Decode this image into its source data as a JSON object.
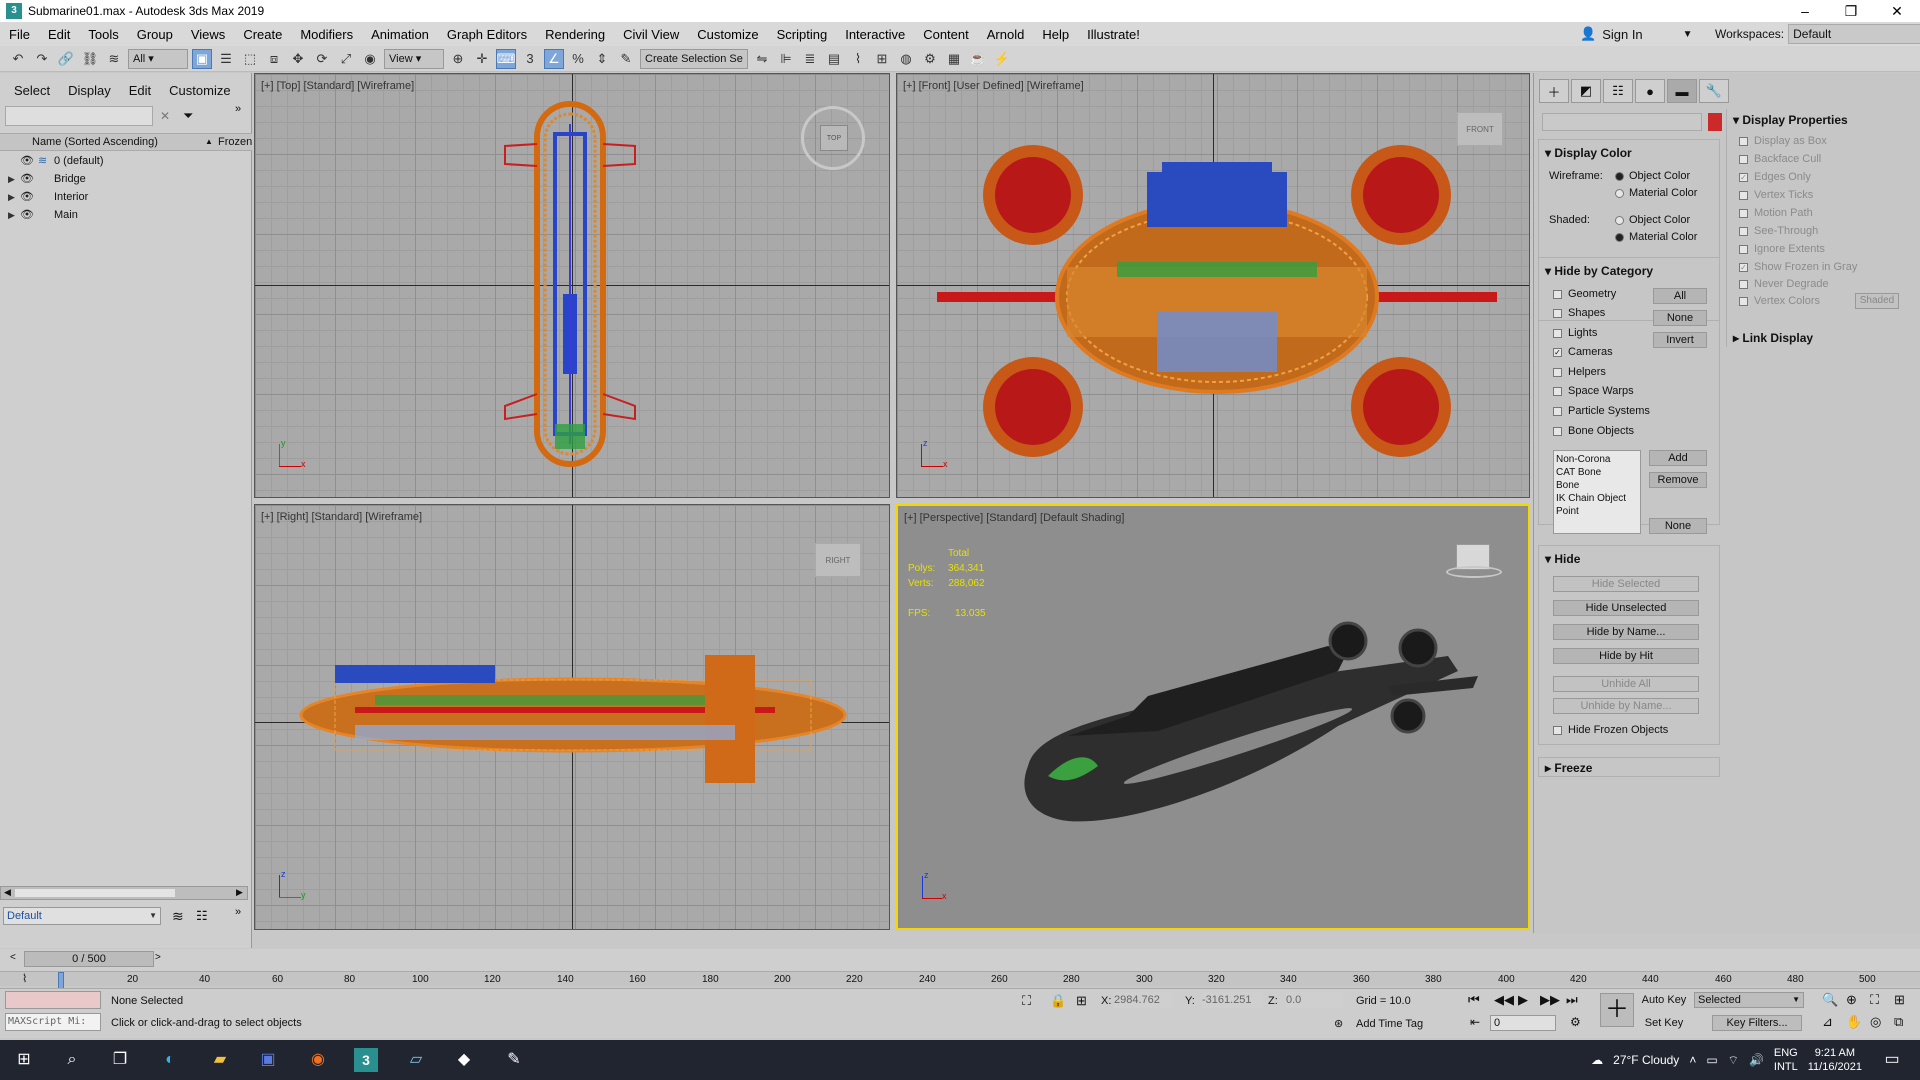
{
  "window": {
    "title": "Submarine01.max - Autodesk 3ds Max 2019",
    "min": "–",
    "max": "❐",
    "close": "✕"
  },
  "menu": [
    "File",
    "Edit",
    "Tools",
    "Group",
    "Views",
    "Create",
    "Modifiers",
    "Animation",
    "Graph Editors",
    "Rendering",
    "Civil View",
    "Customize",
    "Scripting",
    "Interactive",
    "Content",
    "Arnold",
    "Help",
    "Illustrate!"
  ],
  "account": {
    "signin": "Sign In",
    "workspaces_label": "Workspaces:",
    "workspace": "Default"
  },
  "toolbar": {
    "filter": "All",
    "view": "View",
    "selection_set": "Create Selection Se"
  },
  "explorer": {
    "tabs": [
      "Select",
      "Display",
      "Edit",
      "Customize"
    ],
    "column_name": "Name (Sorted Ascending)",
    "column_frozen": "Frozen",
    "layers": [
      "0 (default)",
      "Bridge",
      "Interior",
      "Main"
    ],
    "layer_dropdown": "Default",
    "frame_counter": "0 / 500"
  },
  "viewports": {
    "top": "[+] [Top] [Standard] [Wireframe]",
    "front": "[+] [Front] [User Defined] [Wireframe]",
    "right": "[+] [Right] [Standard] [Wireframe]",
    "perspective": "[+] [Perspective] [Standard] [Default Shading]",
    "nav_top": "TOP",
    "nav_front": "FRONT",
    "nav_right": "RIGHT",
    "stats": {
      "total": "Total",
      "polys_label": "Polys:",
      "polys": "364,341",
      "verts_label": "Verts:",
      "verts": "288,062",
      "fps_label": "FPS:",
      "fps": "13.035"
    }
  },
  "cmdpanel": {
    "display_color": "Display Color",
    "wireframe_label": "Wireframe:",
    "shaded_label": "Shaded:",
    "object_color": "Object Color",
    "material_color": "Material Color",
    "hide_by_category": "Hide by Category",
    "categories": [
      "Geometry",
      "Shapes",
      "Lights",
      "Cameras",
      "Helpers",
      "Space Warps",
      "Particle Systems",
      "Bone Objects"
    ],
    "cat_all": "All",
    "cat_none": "None",
    "cat_invert": "Invert",
    "list_items": [
      "Non-Corona",
      "CAT Bone",
      "Bone",
      "IK Chain Object",
      "Point"
    ],
    "add": "Add",
    "remove": "Remove",
    "none2": "None",
    "hide": "Hide",
    "hide_selected": "Hide Selected",
    "hide_unselected": "Hide Unselected",
    "hide_by_name": "Hide by Name...",
    "hide_by_hit": "Hide by Hit",
    "unhide_all": "Unhide All",
    "unhide_by_name": "Unhide by Name...",
    "hide_frozen": "Hide Frozen Objects",
    "freeze": "Freeze",
    "display_properties": "Display Properties",
    "props": [
      "Display as Box",
      "Backface Cull",
      "Edges Only",
      "Vertex Ticks",
      "Motion Path",
      "See-Through",
      "Ignore Extents",
      "Show Frozen in Gray",
      "Never Degrade",
      "Vertex Colors"
    ],
    "shaded_btn": "Shaded",
    "link_display": "Link Display"
  },
  "timeline": {
    "ticks": [
      "20",
      "40",
      "60",
      "80",
      "100",
      "120",
      "140",
      "160",
      "180",
      "200",
      "220",
      "240",
      "260",
      "280",
      "300",
      "320",
      "340",
      "360",
      "380",
      "400",
      "420",
      "440",
      "460",
      "480",
      "500"
    ]
  },
  "status": {
    "maxscript": "MAXScript Mi:",
    "none_selected": "None Selected",
    "hint": "Click or click-and-drag to select objects",
    "x_label": "X:",
    "x": "2984.762",
    "y_label": "Y:",
    "y": "-3161.251",
    "z_label": "Z:",
    "z": "0.0",
    "grid": "Grid = 10.0",
    "add_time_tag": "Add Time Tag",
    "auto_key": "Auto Key",
    "selected": "Selected",
    "set_key": "Set Key",
    "key_filters": "Key Filters...",
    "frame": "0"
  },
  "taskbar": {
    "weather": "27°F  Cloudy",
    "lang1": "ENG",
    "lang2": "INTL",
    "time": "9:21 AM",
    "date": "11/16/2021"
  },
  "colors": {
    "accent_selected": "#f2d700",
    "object_color": "#cc2a2a",
    "active_tool": "#7fa6d8"
  }
}
